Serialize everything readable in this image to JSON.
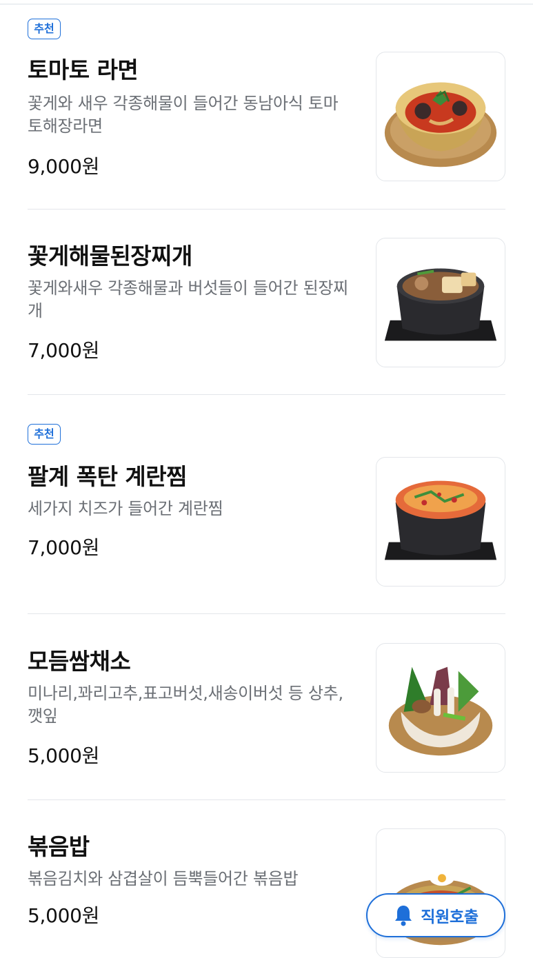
{
  "menu": {
    "items": [
      {
        "badge": "추천",
        "name": "토마토 라면",
        "description": "꽃게와 새우 각종해물이 들어간 동남아식 토마토해장라면",
        "price": "9,000원",
        "image_icon": "tomato-ramen-dish-icon"
      },
      {
        "badge": "",
        "name": "꽃게해물된장찌개",
        "description": "꽃게와새우 각종해물과 버섯들이 들어간 된장찌개",
        "price": "7,000원",
        "image_icon": "doenjang-stew-dish-icon"
      },
      {
        "badge": "추천",
        "name": "팔계 폭탄 계란찜",
        "description": "세가지 치즈가 들어간 계란찜",
        "price": "7,000원",
        "image_icon": "steamed-egg-dish-icon"
      },
      {
        "badge": "",
        "name": "모듬쌈채소",
        "description": "미나리,꽈리고추,표고버섯,새송이버섯 등 상추,깻잎",
        "price": "5,000원",
        "image_icon": "vegetable-wrap-dish-icon"
      },
      {
        "badge": "",
        "name": "볶음밥",
        "description": "볶음김치와 삼겹살이 듬뿍들어간 볶음밥",
        "price": "5,000원",
        "image_icon": "fried-rice-dish-icon"
      }
    ]
  },
  "call_button": {
    "label": "직원호출",
    "icon": "bell-icon"
  },
  "colors": {
    "accent": "#1e6fd9",
    "text": "#111111",
    "muted": "#6b6f75",
    "divider": "#e3e6ea"
  }
}
